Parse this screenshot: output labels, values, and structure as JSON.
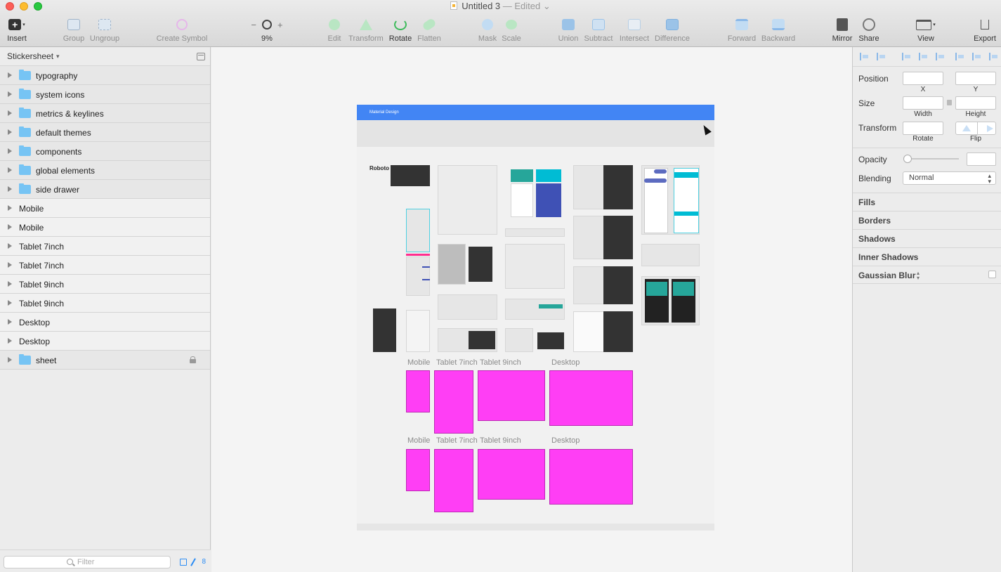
{
  "window": {
    "title": "Untitled 3",
    "status": "— Edited",
    "status_chevron": "⌄"
  },
  "toolbar": {
    "insert": "Insert",
    "group": "Group",
    "ungroup": "Ungroup",
    "create_symbol": "Create Symbol",
    "zoom_minus": "−",
    "zoom_plus": "+",
    "zoom_level": "9%",
    "edit": "Edit",
    "transform": "Transform",
    "rotate": "Rotate",
    "flatten": "Flatten",
    "mask": "Mask",
    "scale": "Scale",
    "union": "Union",
    "subtract": "Subtract",
    "intersect": "Intersect",
    "difference": "Difference",
    "forward": "Forward",
    "backward": "Backward",
    "mirror": "Mirror",
    "share": "Share",
    "view": "View",
    "export": "Export"
  },
  "sidebar": {
    "page_name": "Stickersheet",
    "layers": [
      {
        "label": "typography",
        "kind": "folder"
      },
      {
        "label": "system icons",
        "kind": "folder"
      },
      {
        "label": "metrics & keylines",
        "kind": "folder"
      },
      {
        "label": "default themes",
        "kind": "folder"
      },
      {
        "label": "components",
        "kind": "folder"
      },
      {
        "label": "global elements",
        "kind": "folder"
      },
      {
        "label": "side drawer",
        "kind": "folder"
      },
      {
        "label": "Mobile",
        "kind": "artboard"
      },
      {
        "label": "Mobile",
        "kind": "artboard"
      },
      {
        "label": "Tablet 7inch",
        "kind": "artboard"
      },
      {
        "label": "Tablet 7inch",
        "kind": "artboard"
      },
      {
        "label": "Tablet 9inch",
        "kind": "artboard"
      },
      {
        "label": "Tablet 9inch",
        "kind": "artboard"
      },
      {
        "label": "Desktop",
        "kind": "artboard"
      },
      {
        "label": "Desktop",
        "kind": "artboard"
      },
      {
        "label": "sheet",
        "kind": "folder",
        "locked": true
      }
    ],
    "filter_placeholder": "Filter",
    "count": "8"
  },
  "canvas": {
    "header_title": "Material Design",
    "roboto": "Roboto",
    "artboard_labels_row1": [
      "Mobile",
      "Tablet 7inch",
      "Tablet 9inch",
      "Desktop"
    ],
    "artboard_labels_row2": [
      "Mobile",
      "Tablet 7inch",
      "Tablet 9inch",
      "Desktop"
    ],
    "magenta": "#ff3ef5",
    "header_color": "#4285f4"
  },
  "inspector": {
    "position": "Position",
    "x": "X",
    "y": "Y",
    "size": "Size",
    "width": "Width",
    "height": "Height",
    "transform": "Transform",
    "rotate": "Rotate",
    "flip": "Flip",
    "opacity": "Opacity",
    "blending": "Blending",
    "blending_value": "Normal",
    "fills": "Fills",
    "borders": "Borders",
    "shadows": "Shadows",
    "inner_shadows": "Inner Shadows",
    "gaussian_blur": "Gaussian Blur"
  }
}
